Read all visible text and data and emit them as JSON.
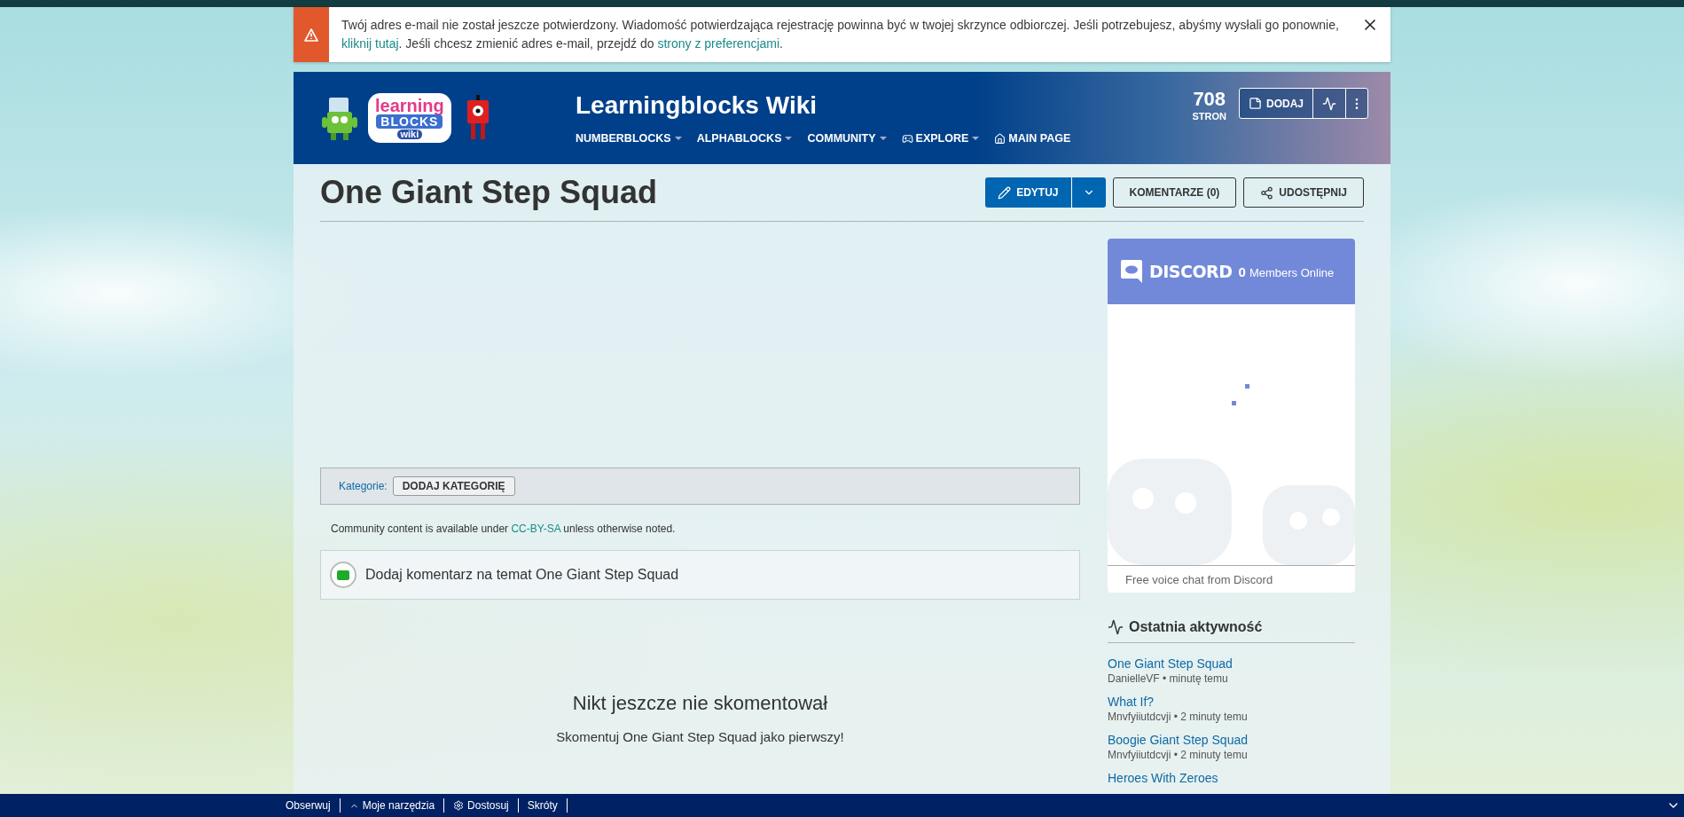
{
  "notice": {
    "parts": [
      {
        "kind": "text",
        "text": "Twój adres e-mail nie został jeszcze potwierdzony. Wiadomość potwierdzająca rejestrację powinna być w twojej skrzynce odbiorczej. Jeśli potrzebujesz, abyśmy wysłali go ponownie, "
      },
      {
        "kind": "link",
        "text": "kliknij tutaj"
      },
      {
        "kind": "text",
        "text": ". Jeśli chcesz zmienić adres e-mail, przejdź do "
      },
      {
        "kind": "link",
        "text": "strony z preferencjami"
      },
      {
        "kind": "text",
        "text": "."
      }
    ]
  },
  "header": {
    "logo": {
      "line1": "learning",
      "line2": "BLOCKS",
      "line3": "wiki"
    },
    "wiki_name": "Learningblocks Wiki",
    "nav": [
      {
        "label": "NUMBERBLOCKS",
        "kind": "dropdown"
      },
      {
        "label": "ALPHABLOCKS",
        "kind": "dropdown"
      },
      {
        "label": "COMMUNITY",
        "kind": "dropdown"
      },
      {
        "label": "EXPLORE",
        "kind": "explore"
      },
      {
        "label": "MAIN PAGE",
        "kind": "home"
      }
    ],
    "page_count": "708",
    "page_count_label": "STRON",
    "add_button": "DODAJ"
  },
  "page": {
    "title": "One Giant Step Squad",
    "edit": "EDYTUJ",
    "comments": "KOMENTARZE (0)",
    "share": "UDOSTĘPNIJ"
  },
  "categories": {
    "label": "Kategorie:",
    "add": "DODAJ KATEGORIĘ"
  },
  "license": {
    "parts": [
      {
        "kind": "text",
        "text": "Community content is available under "
      },
      {
        "kind": "link",
        "text": "CC-BY-SA"
      },
      {
        "kind": "text",
        "text": " unless otherwise noted."
      }
    ]
  },
  "comment_prompt": "Dodaj komentarz na temat One Giant Step Squad",
  "empty_comments": {
    "title": "Nikt jeszcze nie skomentował",
    "subtitle": "Skomentuj One Giant Step Squad jako pierwszy!"
  },
  "discord": {
    "brand": "DISCORD",
    "online_count": "0",
    "online_label": "Members Online",
    "footer": "Free voice chat from Discord"
  },
  "recent_activity": {
    "title": "Ostatnia aktywność",
    "items": [
      {
        "title": "One Giant Step Squad",
        "meta": "DanielleVF • minutę temu"
      },
      {
        "title": "What If?",
        "meta": "Mnvfyiiutdcvji • 2 minuty temu"
      },
      {
        "title": "Boogie Giant Step Squad",
        "meta": "Mnvfyiiutdcvji • 2 minuty temu"
      },
      {
        "title": "Heroes With Zeroes"
      }
    ]
  },
  "toolbar": [
    {
      "label": "Obserwuj",
      "kind": "plain"
    },
    {
      "label": "Moje narzędzia",
      "kind": "menu"
    },
    {
      "label": "Dostosuj",
      "kind": "settings"
    },
    {
      "label": "Skróty",
      "kind": "plain"
    }
  ]
}
